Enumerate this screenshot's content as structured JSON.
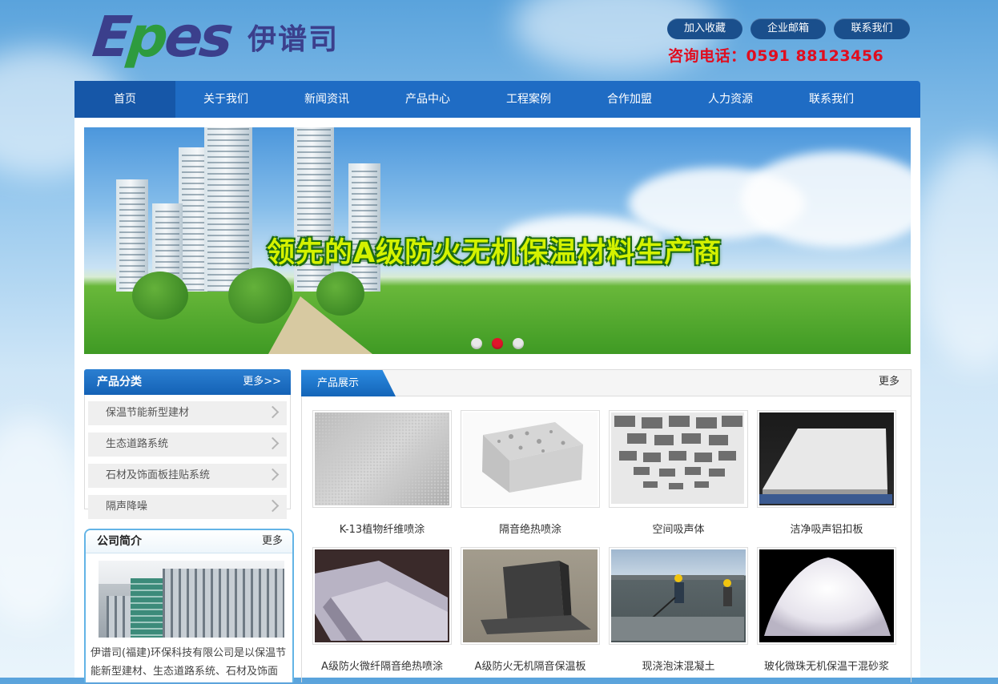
{
  "header": {
    "logo_en": "Epes",
    "logo_cn": "伊谱司",
    "buttons": [
      "加入收藏",
      "企业邮箱",
      "联系我们"
    ],
    "hotline": "咨询电话：0591 88123456"
  },
  "nav": {
    "items": [
      "首页",
      "关于我们",
      "新闻资讯",
      "产品中心",
      "工程案例",
      "合作加盟",
      "人力资源",
      "联系我们"
    ],
    "active_index": 0
  },
  "banner": {
    "slogan": "领先的A级防火无机保温材料生产商",
    "slide_count": 3,
    "active_slide": 2
  },
  "sidebar": {
    "category_title": "产品分类",
    "category_more": "更多>>",
    "categories": [
      "保温节能新型建材",
      "生态道路系统",
      "石材及饰面板挂贴系统",
      "隔声降噪"
    ],
    "intro_title": "公司简介",
    "intro_more": "更多",
    "intro_text": "伊谱司(福建)环保科技有限公司是以保温节能新型建材、生态道路系统、石材及饰面板"
  },
  "products": {
    "title": "产品展示",
    "more": "更多",
    "items": [
      {
        "name": "K-13植物纤维喷涂"
      },
      {
        "name": "隔音绝热喷涂"
      },
      {
        "name": "空间吸声体"
      },
      {
        "name": "洁净吸声铝扣板"
      },
      {
        "name": "A级防火微纤隔音绝热喷涂"
      },
      {
        "name": "A级防火无机隔音保温板"
      },
      {
        "name": "现浇泡沫混凝土"
      },
      {
        "name": "玻化微珠无机保温干混砂浆"
      }
    ]
  },
  "colors": {
    "nav_blue": "#1f6cc4",
    "brand_navy": "#3b3f8c",
    "hotline_red": "#e00d1f",
    "banner_text": "#d4f200"
  }
}
